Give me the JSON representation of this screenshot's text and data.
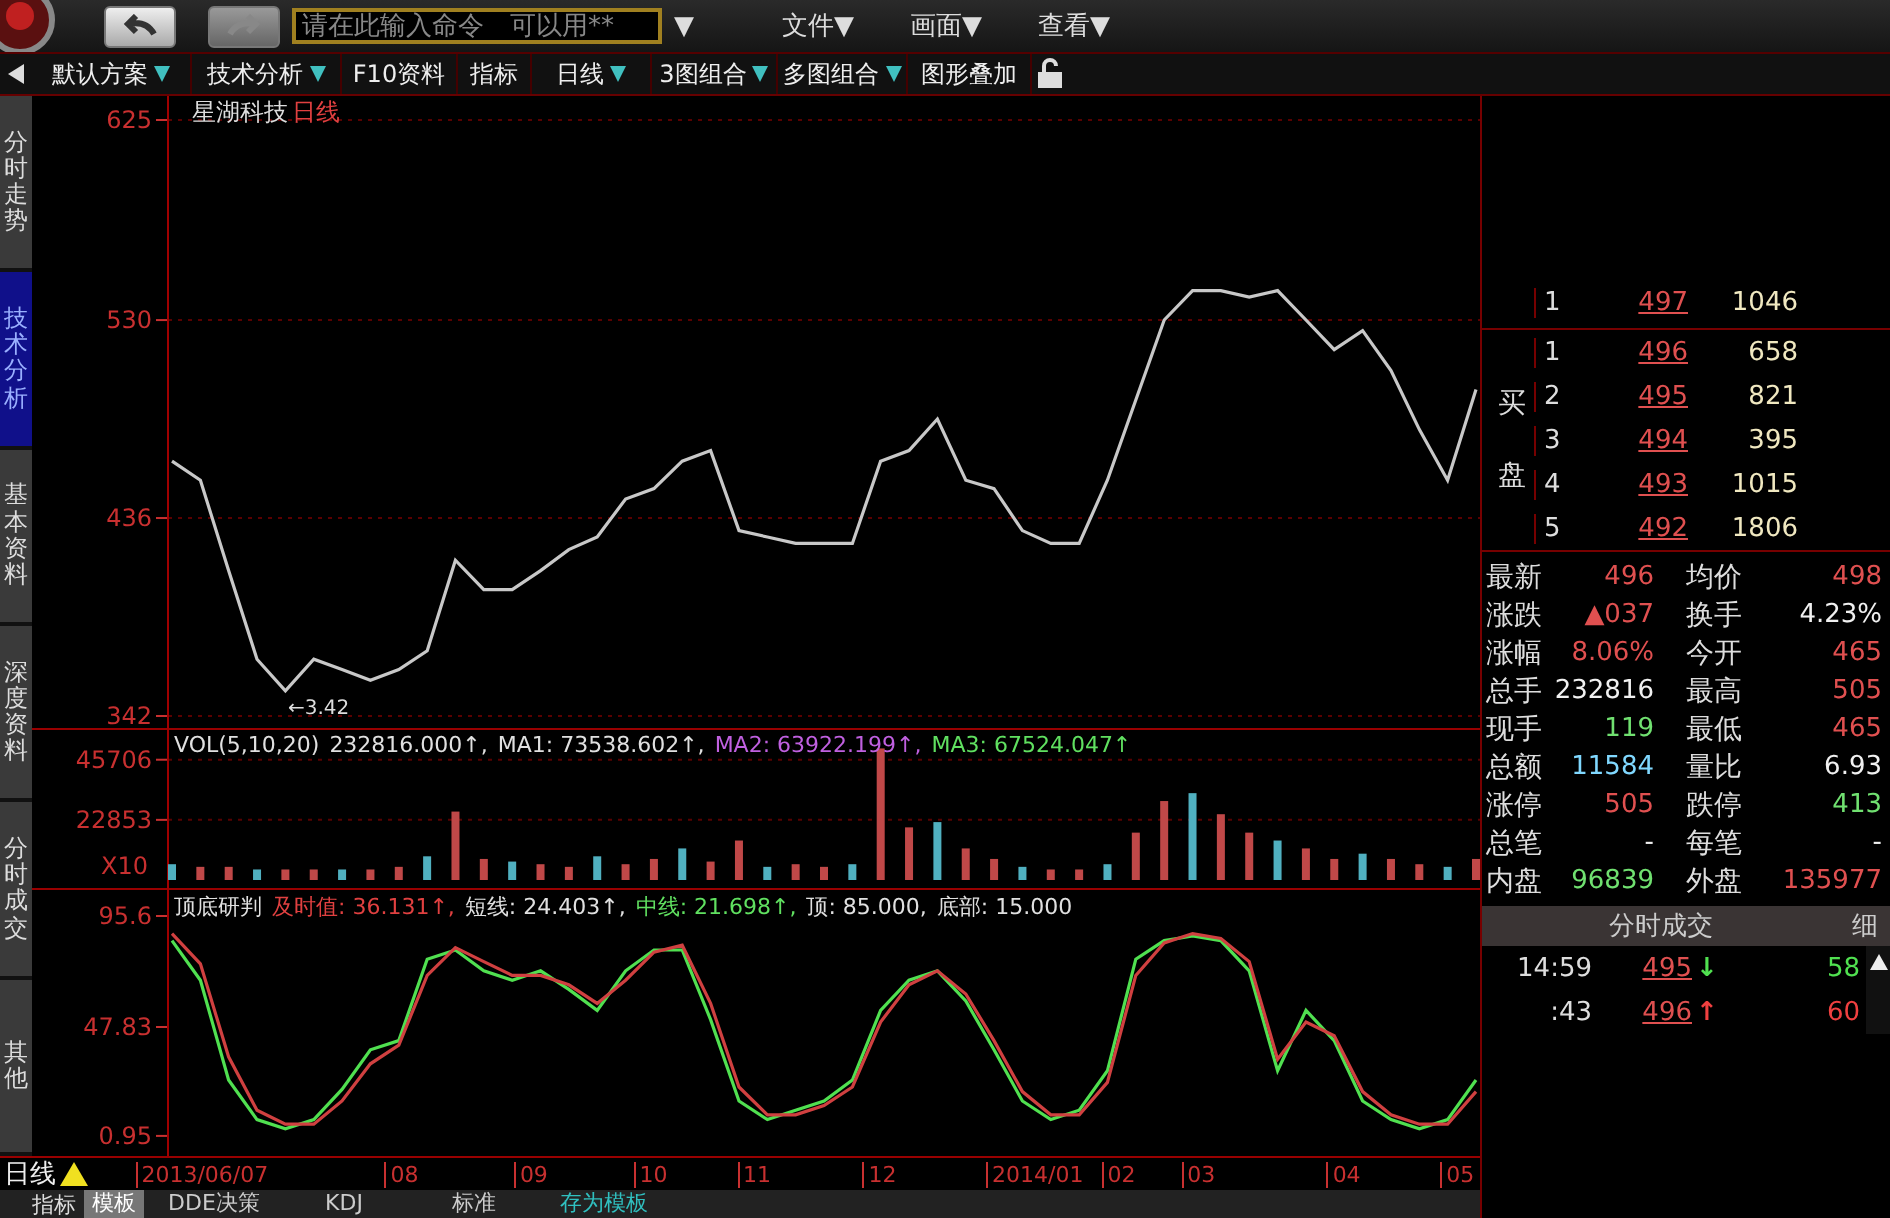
{
  "top_bar": {
    "back_button": {
      "disabled": false
    },
    "forward_button": {
      "disabled": true
    },
    "command_field": {
      "placeholder": "请在此输入命令　可以用**"
    },
    "field_dropdown": "▼",
    "menus": [
      "文件▼",
      "画面▼",
      "查看▼"
    ]
  },
  "toolbar": [
    {
      "label": "默认方案",
      "dropdown": true
    },
    {
      "label": "技术分析",
      "dropdown": true
    },
    {
      "label": "F10资料",
      "dropdown": false
    },
    {
      "label": "指标",
      "dropdown": false
    },
    {
      "label": "日线",
      "dropdown": true
    },
    {
      "label": "3图组合",
      "dropdown": true
    },
    {
      "label": "多图组合",
      "dropdown": true
    },
    {
      "label": "图形叠加",
      "dropdown": false
    }
  ],
  "sidebar_tabs": [
    {
      "label": "分时走势",
      "selected": false
    },
    {
      "label": "技术分析",
      "selected": true
    },
    {
      "label": "基本资料",
      "selected": false
    },
    {
      "label": "深度资料",
      "selected": false
    },
    {
      "label": "分时成交",
      "selected": false
    },
    {
      "label": "其他",
      "selected": false
    }
  ],
  "price_panel": {
    "stock_name": "星湖科技",
    "period": "日线",
    "low_marker": "←3.42",
    "chart_data": {
      "type": "line",
      "ylim": [
        342,
        625
      ],
      "yticks": [
        342,
        436,
        530,
        625
      ],
      "values": [
        463,
        454,
        411,
        369,
        354,
        369,
        364,
        359,
        364,
        373,
        416,
        402,
        402,
        411,
        421,
        427,
        445,
        450,
        463,
        468,
        430,
        427,
        424,
        424,
        424,
        463,
        468,
        483,
        454,
        450,
        430,
        424,
        424,
        454,
        492,
        530,
        544,
        544,
        541,
        544,
        530,
        516,
        525,
        506,
        478,
        454,
        497
      ]
    }
  },
  "volume_panel": {
    "legend": [
      {
        "text": "VOL(5,10,20)",
        "color": "#e0e0e0"
      },
      {
        "text": "232816.000↑,",
        "color": "#e0e0e0"
      },
      {
        "text": "MA1: 73538.602↑,",
        "color": "#e0e0e0"
      },
      {
        "text": "MA2: 63922.199↑,",
        "color": "#c060e0"
      },
      {
        "text": "MA3: 67524.047↑",
        "color": "#60e060"
      }
    ],
    "scale_label": "X10",
    "chart_data": {
      "type": "bar",
      "ylim": [
        0,
        57000
      ],
      "yticks": [
        22853,
        45706
      ],
      "values": [
        6000,
        5000,
        5000,
        4000,
        4000,
        4000,
        4000,
        4000,
        5000,
        9000,
        26000,
        8000,
        7000,
        6000,
        5000,
        9000,
        6000,
        8000,
        12000,
        7000,
        15000,
        5000,
        6000,
        5000,
        6000,
        50000,
        20000,
        22000,
        12000,
        8000,
        5000,
        4000,
        4000,
        6000,
        18000,
        30000,
        33000,
        25000,
        18000,
        15000,
        12000,
        8000,
        10000,
        8000,
        6000,
        5000,
        8000
      ]
    }
  },
  "indicator_panel": {
    "legend": [
      {
        "text": "顶底研判",
        "color": "#e0e0e0"
      },
      {
        "text": "及时值: 36.131↑,",
        "color": "#e04040"
      },
      {
        "text": "短线: 24.403↑,",
        "color": "#e0e0e0"
      },
      {
        "text": "中线: 21.698↑,",
        "color": "#60e060"
      },
      {
        "text": "顶: 85.000,",
        "color": "#e0e0e0"
      },
      {
        "text": "底部: 15.000",
        "color": "#e0e0e0"
      }
    ],
    "chart_data": {
      "type": "line",
      "ylim": [
        -7.7,
        106.8
      ],
      "yticks": [
        0.95,
        47.83,
        95.6
      ],
      "series": [
        {
          "color": "#50e050",
          "values": [
            85,
            68,
            25,
            8,
            4,
            8,
            21,
            38,
            42,
            77,
            81,
            72,
            68,
            72,
            64,
            55,
            72,
            81,
            81,
            51,
            16,
            8,
            12,
            16,
            25,
            55,
            68,
            72,
            59,
            38,
            16,
            8,
            12,
            29,
            77,
            85,
            87,
            85,
            72,
            29,
            55,
            42,
            16,
            8,
            4,
            8,
            25
          ]
        },
        {
          "color": "#d04040",
          "values": [
            88,
            75,
            35,
            12,
            6,
            6,
            16,
            32,
            40,
            70,
            82,
            76,
            70,
            70,
            66,
            58,
            68,
            80,
            83,
            58,
            22,
            10,
            10,
            14,
            22,
            50,
            66,
            72,
            62,
            42,
            20,
            10,
            10,
            24,
            70,
            84,
            88,
            86,
            76,
            34,
            50,
            44,
            20,
            10,
            6,
            6,
            20
          ]
        }
      ]
    }
  },
  "order_book": {
    "sell": [
      {
        "rank": "1",
        "price": "497",
        "volume": "1046"
      }
    ],
    "buy_label": "买盘",
    "buy": [
      {
        "rank": "1",
        "price": "496",
        "volume": "658"
      },
      {
        "rank": "2",
        "price": "495",
        "volume": "821"
      },
      {
        "rank": "3",
        "price": "494",
        "volume": "395"
      },
      {
        "rank": "4",
        "price": "493",
        "volume": "1015"
      },
      {
        "rank": "5",
        "price": "492",
        "volume": "1806"
      }
    ]
  },
  "stats": [
    {
      "label": "最新",
      "value": "496",
      "color": "#e05050"
    },
    {
      "label": "均价",
      "value": "498",
      "color": "#e05050"
    },
    {
      "label": "涨跌",
      "value": "▲037",
      "color": "#e05050"
    },
    {
      "label": "换手",
      "value": "4.23%",
      "color": "#f0f0f0"
    },
    {
      "label": "涨幅",
      "value": "8.06%",
      "color": "#e05050"
    },
    {
      "label": "今开",
      "value": "465",
      "color": "#e05050"
    },
    {
      "label": "总手",
      "value": "232816",
      "color": "#f0f0f0"
    },
    {
      "label": "最高",
      "value": "505",
      "color": "#e05050"
    },
    {
      "label": "现手",
      "value": "119",
      "color": "#70e070"
    },
    {
      "label": "最低",
      "value": "465",
      "color": "#e05050"
    },
    {
      "label": "总额",
      "value": "11584",
      "color": "#80d8ff"
    },
    {
      "label": "量比",
      "value": "6.93",
      "color": "#f0f0f0"
    },
    {
      "label": "涨停",
      "value": "505",
      "color": "#e05050"
    },
    {
      "label": "跌停",
      "value": "413",
      "color": "#70e070"
    },
    {
      "label": "总笔",
      "value": "-",
      "color": "#f0f0f0"
    },
    {
      "label": "每笔",
      "value": "-",
      "color": "#f0f0f0"
    },
    {
      "label": "内盘",
      "value": "96839",
      "color": "#70e070"
    },
    {
      "label": "外盘",
      "value": "135977",
      "color": "#e05050"
    }
  ],
  "trades": {
    "title": "分时成交",
    "detail_tab": "细",
    "rows": [
      {
        "time": "14:59",
        "price": "495",
        "arrow": "↓",
        "color": "#50e050",
        "volume": "58"
      },
      {
        "time": ":43",
        "price": "496",
        "arrow": "↑",
        "color": "#f04040",
        "volume": "60"
      }
    ]
  },
  "date_axis": {
    "period": "日线",
    "labels": [
      "2013/06/07",
      "08",
      "09",
      "10",
      "11",
      "12",
      "2014/01",
      "02",
      "03",
      "04",
      "05"
    ]
  },
  "bottom_bar": {
    "label": "指标",
    "tabs": [
      {
        "label": "模板",
        "selected": true,
        "kind": "tab"
      },
      {
        "label": "DDE决策",
        "selected": false,
        "kind": "tab"
      },
      {
        "label": "KDJ",
        "selected": false,
        "kind": "tab"
      },
      {
        "label": "标准",
        "selected": false,
        "kind": "tab"
      },
      {
        "label": "存为模板",
        "selected": false,
        "kind": "action"
      }
    ]
  }
}
